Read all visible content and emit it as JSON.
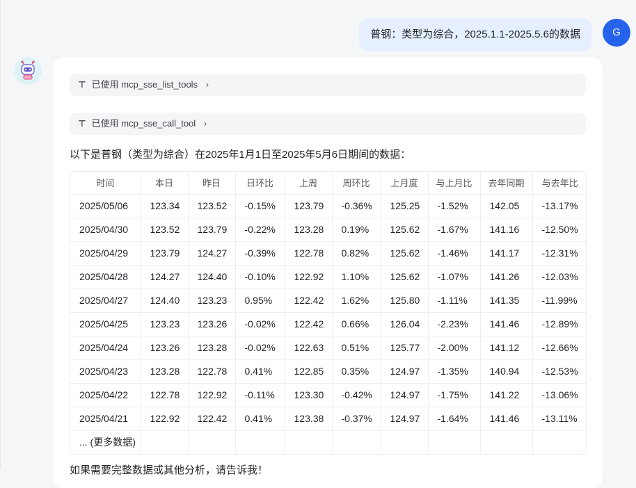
{
  "user": {
    "message": "普钢：类型为综合，2025.1.1-2025.5.6的数据",
    "avatar_letter": "G"
  },
  "bot": {
    "tools": [
      {
        "icon": "tool-icon",
        "label": "已使用 mcp_sse_list_tools",
        "chevron": "›"
      },
      {
        "icon": "tool-icon",
        "label": "已使用 mcp_sse_call_tool",
        "chevron": "›"
      }
    ],
    "intro": "以下是普钢（类型为综合）在2025年1月1日至2025年5月6日期间的数据：",
    "table": {
      "headers": [
        "时间",
        "本日",
        "昨日",
        "日环比",
        "上周",
        "周环比",
        "上月度",
        "与上月比",
        "去年同期",
        "与去年比"
      ],
      "rows": [
        [
          "2025/05/06",
          "123.34",
          "123.52",
          "-0.15%",
          "123.79",
          "-0.36%",
          "125.25",
          "-1.52%",
          "142.05",
          "-13.17%"
        ],
        [
          "2025/04/30",
          "123.52",
          "123.79",
          "-0.22%",
          "123.28",
          "0.19%",
          "125.62",
          "-1.67%",
          "141.16",
          "-12.50%"
        ],
        [
          "2025/04/29",
          "123.79",
          "124.27",
          "-0.39%",
          "122.78",
          "0.82%",
          "125.62",
          "-1.46%",
          "141.17",
          "-12.31%"
        ],
        [
          "2025/04/28",
          "124.27",
          "124.40",
          "-0.10%",
          "122.92",
          "1.10%",
          "125.62",
          "-1.07%",
          "141.26",
          "-12.03%"
        ],
        [
          "2025/04/27",
          "124.40",
          "123.23",
          "0.95%",
          "122.42",
          "1.62%",
          "125.80",
          "-1.11%",
          "141.35",
          "-11.99%"
        ],
        [
          "2025/04/25",
          "123.23",
          "123.26",
          "-0.02%",
          "122.42",
          "0.66%",
          "126.04",
          "-2.23%",
          "141.46",
          "-12.89%"
        ],
        [
          "2025/04/24",
          "123.26",
          "123.28",
          "-0.02%",
          "122.63",
          "0.51%",
          "125.77",
          "-2.00%",
          "141.12",
          "-12.66%"
        ],
        [
          "2025/04/23",
          "123.28",
          "122.78",
          "0.41%",
          "122.85",
          "0.35%",
          "124.97",
          "-1.35%",
          "140.94",
          "-12.53%"
        ],
        [
          "2025/04/22",
          "122.78",
          "122.92",
          "-0.11%",
          "123.30",
          "-0.42%",
          "124.97",
          "-1.75%",
          "141.22",
          "-13.06%"
        ],
        [
          "2025/04/21",
          "122.92",
          "122.42",
          "0.41%",
          "123.38",
          "-0.37%",
          "124.97",
          "-1.64%",
          "141.46",
          "-13.11%"
        ],
        [
          "... (更多数据)",
          "",
          "",
          "",
          "",
          "",
          "",
          "",
          "",
          ""
        ]
      ]
    },
    "footer": "如果需要完整数据或其他分析，请告诉我！"
  }
}
